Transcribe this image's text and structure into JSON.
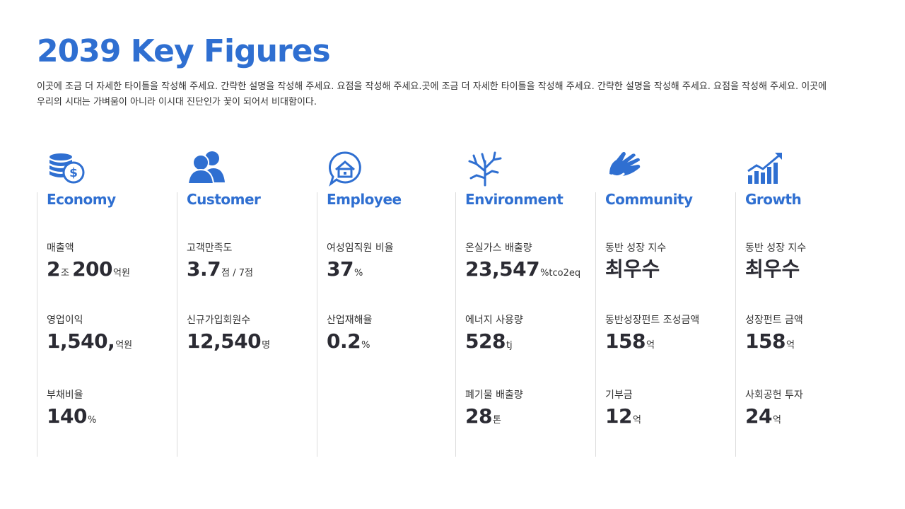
{
  "title": "2039 Key Figures",
  "description": "이곳에 조금 더 자세한 타이틀을 작성해 주세요. 간략한 설명을 작성해 주세요. 요점을 작성해 주세요.곳에 조금 더 자세한 타이틀을 작성해 주세요. 간략한 설명을 작성해 주세요. 요점을 작성해 주세요. 이곳에 우리의 시대는 가벼움이 아니라 이시대 진단인가 꽃이 되어서 비대함이다.",
  "colors": {
    "accent": "#2f6fd1",
    "text": "#2b2b33",
    "rule": "#dcdcdc"
  },
  "columns": [
    {
      "category": "Economy",
      "icon": "coins-dollar-icon",
      "metrics": [
        {
          "label": "매출액",
          "parts": [
            {
              "n": "2"
            },
            {
              "u": "조 "
            },
            {
              "n": "200"
            },
            {
              "u": "억원"
            }
          ]
        },
        {
          "label": "영업이익",
          "parts": [
            {
              "n": "1,540,"
            },
            {
              "u": "억원"
            }
          ]
        },
        {
          "label": "부채비율",
          "parts": [
            {
              "n": "140"
            },
            {
              "u": "%"
            }
          ]
        }
      ]
    },
    {
      "category": "Customer",
      "icon": "users-icon",
      "metrics": [
        {
          "label": "고객만족도",
          "parts": [
            {
              "n": "3.7"
            },
            {
              "u": "점 / 7점"
            }
          ]
        },
        {
          "label": "신규가입회원수",
          "parts": [
            {
              "n": "12,540"
            },
            {
              "u": "명"
            }
          ]
        }
      ]
    },
    {
      "category": "Employee",
      "icon": "house-chat-icon",
      "metrics": [
        {
          "label": "여성임직원 비율",
          "parts": [
            {
              "n": "37"
            },
            {
              "u": "%"
            }
          ]
        },
        {
          "label": "산업재해율",
          "parts": [
            {
              "n": "0.2"
            },
            {
              "u": "%"
            }
          ]
        }
      ]
    },
    {
      "category": "Environment",
      "icon": "tree-icon",
      "metrics": [
        {
          "label": "온실가스 배출량",
          "parts": [
            {
              "n": "23,547"
            },
            {
              "u": "%tco2eq"
            }
          ]
        },
        {
          "label": "에너지 사용량",
          "parts": [
            {
              "n": "528"
            },
            {
              "u": "tj"
            }
          ]
        },
        {
          "label": "폐기물 배출량",
          "parts": [
            {
              "n": "28"
            },
            {
              "u": "톤"
            }
          ]
        }
      ]
    },
    {
      "category": "Community",
      "icon": "hand-icon",
      "metrics": [
        {
          "label": "동반 성장 지수",
          "parts": [
            {
              "k": "최우수"
            }
          ]
        },
        {
          "label": "동반성장펀트 조성금액",
          "parts": [
            {
              "n": "158"
            },
            {
              "u": "억"
            }
          ]
        },
        {
          "label": "기부금",
          "parts": [
            {
              "n": "12"
            },
            {
              "u": "억"
            }
          ]
        }
      ]
    },
    {
      "category": "Growth",
      "icon": "growth-chart-icon",
      "metrics": [
        {
          "label": "동반 성장 지수",
          "parts": [
            {
              "k": "최우수"
            }
          ]
        },
        {
          "label": "성장펀트 금액",
          "parts": [
            {
              "n": "158"
            },
            {
              "u": "억"
            }
          ]
        },
        {
          "label": "사회공헌 투자",
          "parts": [
            {
              "n": "24"
            },
            {
              "u": "억"
            }
          ]
        }
      ]
    }
  ]
}
